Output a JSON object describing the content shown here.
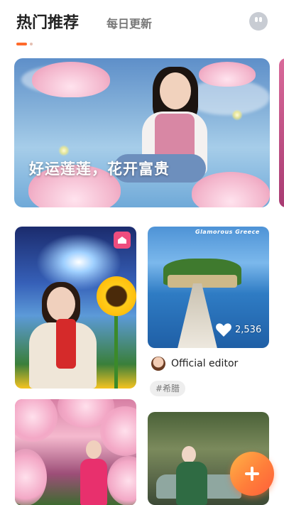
{
  "header": {
    "tab_active": "热门推荐",
    "tab_inactive": "每日更新",
    "avatar_icon": "robot-face-icon"
  },
  "carousel": {
    "active_index": 0,
    "total": 2,
    "banner_caption": "好运莲莲，花开富贵"
  },
  "feed": {
    "cards": [
      {
        "id": "card1",
        "badge_icon": "shop-icon"
      },
      {
        "id": "card2",
        "brand_text": "Glamorous Greece",
        "likes": "2,536",
        "author": "Official editor",
        "tag": "#希腊"
      },
      {
        "id": "card3"
      },
      {
        "id": "card4"
      }
    ]
  },
  "fab": {
    "icon": "plus-icon"
  },
  "colors": {
    "accent": "#ff6a2b",
    "badge": "#ee4d7e",
    "fab_start": "#ffb347",
    "fab_end": "#ff5e3a"
  }
}
